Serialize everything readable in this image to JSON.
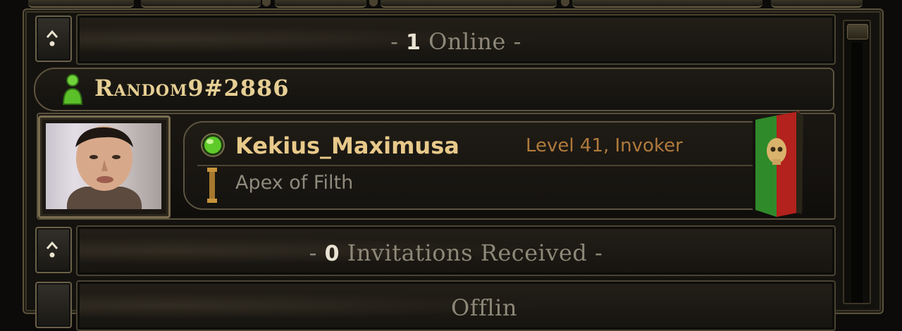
{
  "sections": {
    "online": {
      "prefix": "- ",
      "count": "1",
      "label": " Online -"
    },
    "invitations": {
      "prefix": "- ",
      "count": "0",
      "label": " Invitations Received -"
    },
    "offline": {
      "prefix": "",
      "count": "",
      "label": "Offlin"
    }
  },
  "account": {
    "battletag": "Random9#2886",
    "icon": "player-icon",
    "icon_color": "#6fd23a"
  },
  "friend": {
    "character_name": "Kekius_Maximusa",
    "level_class": "Level 41, Invoker",
    "guild": "Apex of Filth",
    "status": "online",
    "status_icon": "online-status-icon",
    "status_color": "#5ecb2a",
    "portrait": "character-portrait",
    "banner": "clan-banner-icon",
    "banner_colors": [
      "#2f8a2a",
      "#b3221c"
    ]
  },
  "icons": {
    "collapse": "chevron-up-icon"
  },
  "colors": {
    "name_gold": "#e8c98a",
    "level_orange": "#b07a3c",
    "muted_text": "#8d8878"
  }
}
